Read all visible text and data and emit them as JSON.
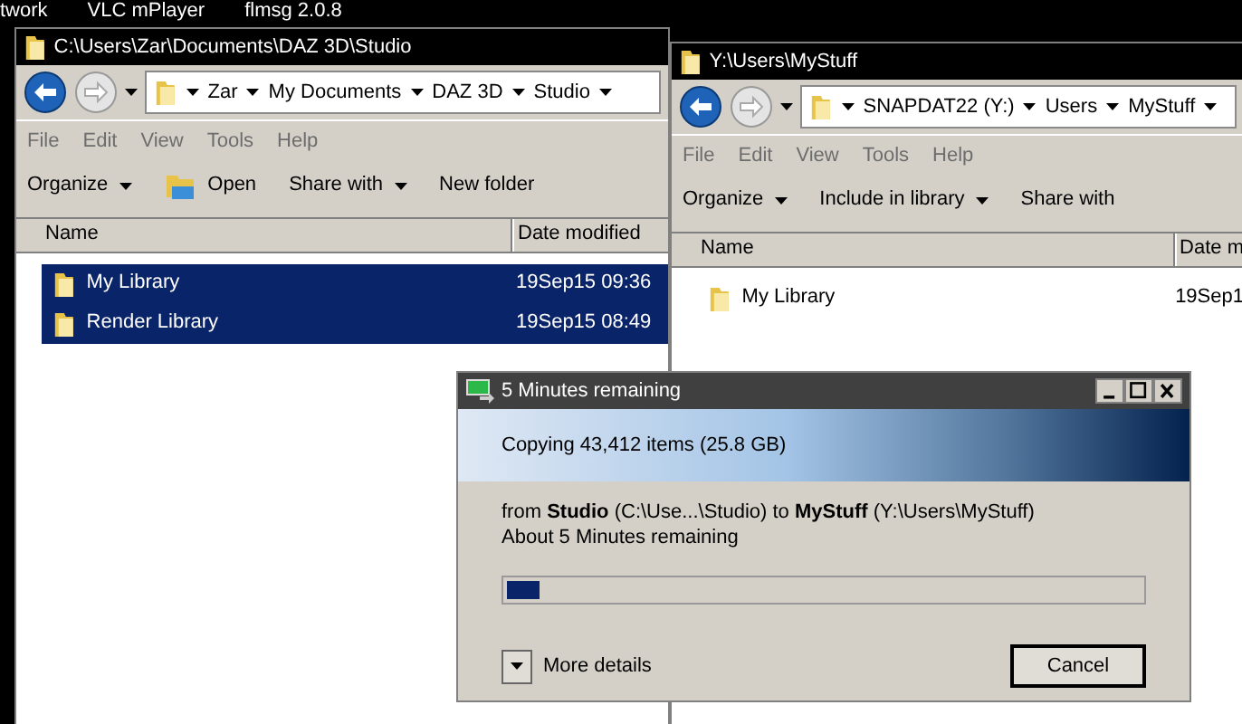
{
  "desktop_icons": [
    {
      "label": "twork"
    },
    {
      "label": "VLC mPlayer"
    },
    {
      "label": "flmsg 2.0.8"
    }
  ],
  "windows": [
    {
      "title": "C:\\Users\\Zar\\Documents\\DAZ 3D\\Studio",
      "breadcrumb": [
        "Zar",
        "My Documents",
        "DAZ 3D",
        "Studio"
      ],
      "menu": [
        "File",
        "Edit",
        "View",
        "Tools",
        "Help"
      ],
      "toolbar": [
        {
          "label": "Organize",
          "dropdown": true,
          "has_icon": false
        },
        {
          "label": "Open",
          "dropdown": false,
          "has_icon": true
        },
        {
          "label": "Share with",
          "dropdown": true,
          "has_icon": false
        },
        {
          "label": "New folder",
          "dropdown": false,
          "has_icon": false
        }
      ],
      "columns": [
        "Name",
        "Date modified"
      ],
      "rows": [
        {
          "name": "My Library",
          "date": "19Sep15 09:36",
          "selected": true
        },
        {
          "name": "Render Library",
          "date": "19Sep15 08:49",
          "selected": true
        }
      ]
    },
    {
      "title": "Y:\\Users\\MyStuff",
      "breadcrumb": [
        "SNAPDAT22 (Y:)",
        "Users",
        "MyStuff"
      ],
      "menu": [
        "File",
        "Edit",
        "View",
        "Tools",
        "Help"
      ],
      "toolbar": [
        {
          "label": "Organize",
          "dropdown": true,
          "has_icon": false
        },
        {
          "label": "Include in library",
          "dropdown": true,
          "has_icon": false
        },
        {
          "label": "Share with",
          "dropdown": false,
          "has_icon": false
        }
      ],
      "columns": [
        "Name",
        "Date m"
      ],
      "rows": [
        {
          "name": "My Library",
          "date": "19Sep1",
          "selected": false
        }
      ]
    }
  ],
  "dialog": {
    "title": "5 Minutes remaining",
    "header": "Copying 43,412 items (25.8 GB)",
    "from_line": "from **Studio** (C:\\Use...\\Studio) to **MyStuff** (Y:\\Users\\MyStuff)",
    "time_line": "About 5 Minutes remaining",
    "progress": {
      "level": 0.05
    },
    "details_toggle": "More details",
    "cancel": "Cancel"
  }
}
